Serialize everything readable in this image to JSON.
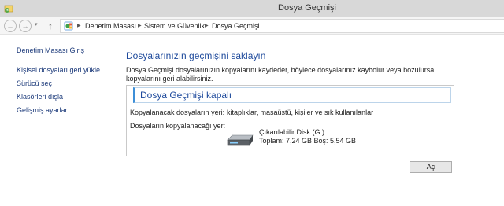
{
  "window": {
    "title": "Dosya Geçmişi",
    "icon": "file-history-app-icon"
  },
  "addressbar": {
    "back_glyph": "←",
    "forward_glyph": "→",
    "recent_glyph": "▾",
    "up_glyph": "↑",
    "breadcrumbs": [
      "Denetim Masası",
      "Sistem ve Güvenlik",
      "Dosya Geçmişi"
    ],
    "separator_glyph": "▶"
  },
  "sidebar": {
    "items": [
      {
        "label": "Denetim Masası Giriş"
      },
      {
        "label": "Kişisel dosyaları geri yükle"
      },
      {
        "label": "Sürücü seç"
      },
      {
        "label": "Klasörleri dışla"
      },
      {
        "label": "Gelişmiş ayarlar"
      }
    ]
  },
  "main": {
    "title": "Dosyalarınızın geçmişini saklayın",
    "description": "Dosya Geçmişi dosyalarınızın kopyalarını kaydeder, böylece dosyalarınız kaybolur veya bozulursa kopyalarını geri alabilirsiniz.",
    "status_panel": {
      "title": "Dosya Geçmişi kapalı",
      "copy_source_label": "Kopyalanacak dosyaların yeri:",
      "copy_source_value": "kitaplıklar, masaüstü, kişiler ve sık kullanılanlar",
      "copy_target_label": "Dosyaların kopyalanacağı yer:",
      "drive_name": "Çıkarılabilir Disk (G:)",
      "drive_space": "Toplam: 7,24 GB Boş: 5,54 GB"
    },
    "turn_on_label": "Aç"
  },
  "colors": {
    "link": "#1c3a7a",
    "heading": "#1e4a9c",
    "panel_accent": "#3d8fd8",
    "titlebar": "#d8d8d8"
  }
}
